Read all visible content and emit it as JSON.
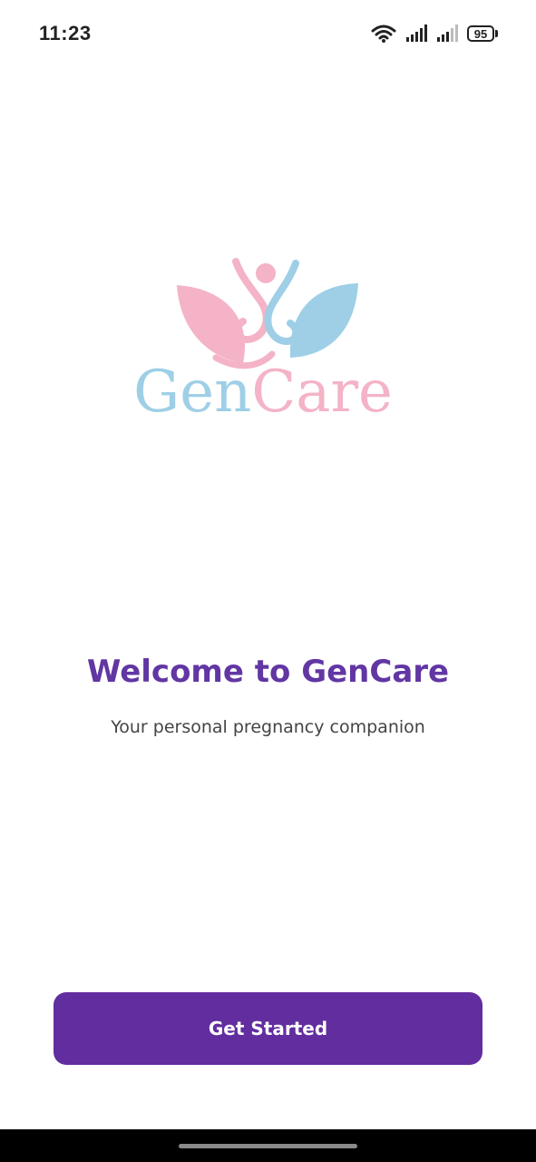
{
  "status_bar": {
    "time": "11:23",
    "battery_level": "95",
    "icons": [
      "wifi-icon",
      "cellular-signal-icon",
      "cellular-signal-icon",
      "battery-icon"
    ]
  },
  "logo": {
    "word_part1": "Gen",
    "word_part2": "Care",
    "colors": {
      "blue": "#9ecfe6",
      "pink": "#f4b3c6"
    }
  },
  "welcome": {
    "title": "Welcome to GenCare",
    "subtitle": "Your personal pregnancy companion"
  },
  "cta": {
    "label": "Get Started",
    "color": "#622d9e"
  },
  "theme": {
    "accent": "#6236a3",
    "background": "#ffffff"
  }
}
